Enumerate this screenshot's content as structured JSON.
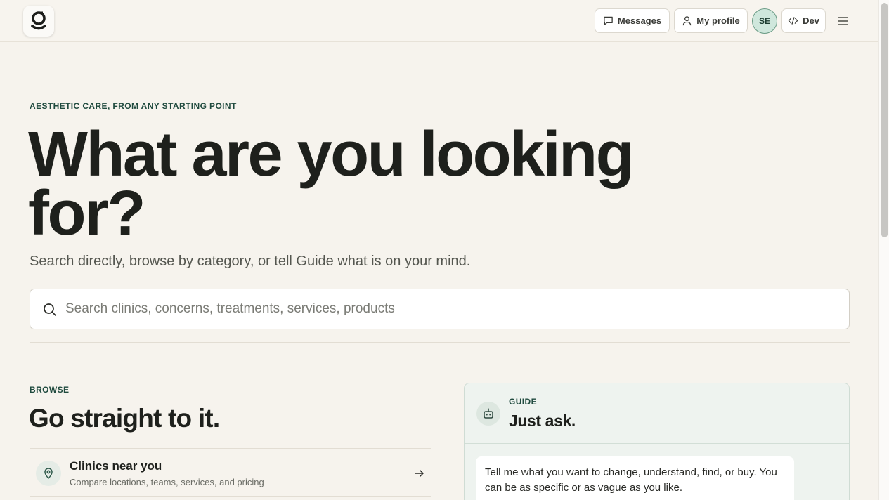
{
  "nav": {
    "messages_label": "Messages",
    "profile_label": "My profile",
    "avatar_initials": "SE",
    "dev_label": "Dev"
  },
  "hero": {
    "eyebrow": "AESTHETIC CARE, FROM ANY STARTING POINT",
    "title": "What are you looking for?",
    "subtitle": "Search directly, browse by category, or tell Guide what is on your mind."
  },
  "search": {
    "placeholder": "Search clinics, concerns, treatments, services, products",
    "value": ""
  },
  "browse": {
    "eyebrow": "BROWSE",
    "title": "Go straight to it.",
    "items": [
      {
        "title": "Clinics near you",
        "description": "Compare locations, teams, services, and pricing",
        "icon": "map-pin-icon"
      }
    ]
  },
  "guide": {
    "eyebrow": "GUIDE",
    "title": "Just ask.",
    "message": "Tell me what you want to change, understand, find, or buy. You can be as specific or as vague as you like."
  },
  "colors": {
    "background": "#f6f3ed",
    "accent": "#1f4a3e",
    "avatar_bg": "#cfe7dc",
    "guide_bg": "#eef3ef"
  }
}
